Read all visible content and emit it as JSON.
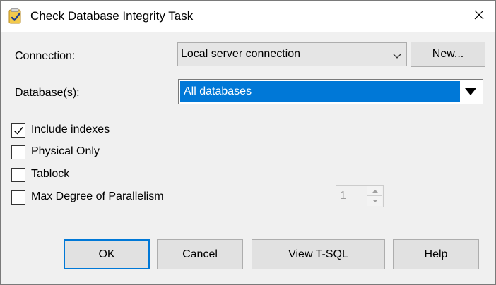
{
  "window": {
    "title": "Check Database Integrity Task",
    "icon": "task-icon",
    "close_icon": "close-icon"
  },
  "connection": {
    "label": "Connection:",
    "value": "Local server connection",
    "new_button": "New..."
  },
  "databases": {
    "label": "Database(s):",
    "value": "All databases"
  },
  "options": [
    {
      "label": "Include indexes",
      "checked": true
    },
    {
      "label": "Physical Only",
      "checked": false
    },
    {
      "label": "Tablock",
      "checked": false
    },
    {
      "label": "Max Degree of Parallelism",
      "checked": false
    }
  ],
  "parallelism": {
    "value": "1"
  },
  "buttons": {
    "ok": "OK",
    "cancel": "Cancel",
    "view_tsql": "View T-SQL",
    "help": "Help"
  },
  "colors": {
    "accent": "#0078d7",
    "window_bg": "#f0f0f0",
    "button_bg": "#e1e1e1"
  }
}
